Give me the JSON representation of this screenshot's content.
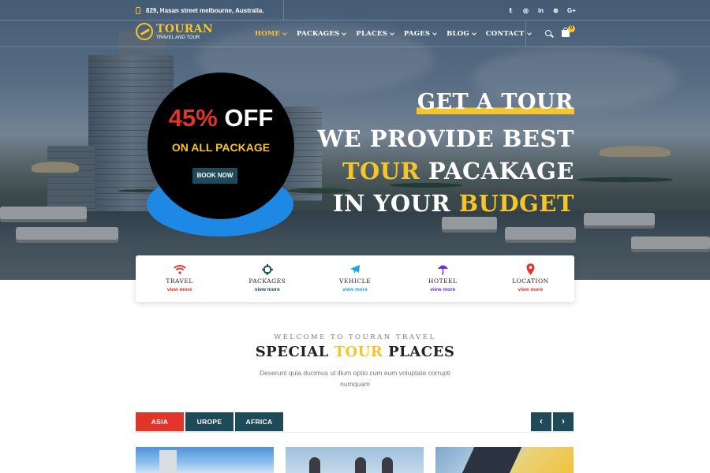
{
  "topbar": {
    "address": "829, Hasan street melbourne, Australia.",
    "socials": [
      {
        "icon": "twitter-icon",
        "glyph": "𝕥"
      },
      {
        "icon": "instagram-icon",
        "glyph": "◎"
      },
      {
        "icon": "linkedin-icon",
        "glyph": "in"
      },
      {
        "icon": "dribbble-icon",
        "glyph": "⊛"
      },
      {
        "icon": "google-plus-icon",
        "glyph": "G+"
      }
    ]
  },
  "brand": {
    "name": "TOURAN",
    "tagline": "TRAVEL AND TOUR"
  },
  "nav": {
    "items": [
      {
        "label": "HOME",
        "active": true
      },
      {
        "label": "PACKAGES"
      },
      {
        "label": "PLACES"
      },
      {
        "label": "PAGES"
      },
      {
        "label": "BLOG"
      },
      {
        "label": "CONTACT"
      }
    ],
    "cart_count": "0"
  },
  "offer": {
    "percent": "45%",
    "off": "OFF",
    "subtitle": "ON ALL PACKAGE",
    "button": "BOOK NOW"
  },
  "hero": {
    "kicker": "GET A TOUR",
    "line1": "WE PROVIDE BEST",
    "line2_highlight": "TOUR",
    "line2_rest": "PACAKAGE",
    "line3_start": "IN YOUR",
    "line3_highlight": "BUDGET"
  },
  "features": [
    {
      "title": "TRAVEL",
      "link": "view more",
      "icon": "wifi-icon",
      "color": "#e3342a"
    },
    {
      "title": "PACKAGES",
      "link": "view more",
      "icon": "crosshair-icon",
      "color": "#1e4a5a"
    },
    {
      "title": "VEHICLE",
      "link": "view more",
      "icon": "airplane-icon",
      "color": "#1ba8d8"
    },
    {
      "title": "HOTEEL",
      "link": "view more",
      "icon": "umbrella-icon",
      "color": "#6a2fd6"
    },
    {
      "title": "LOCATION",
      "link": "view more",
      "icon": "map-pin-icon",
      "color": "#e3342a"
    }
  ],
  "places_section": {
    "kicker": "WELCOME TO TOURAN TRAVEL",
    "title_start": "SPECIAL",
    "title_highlight": "TOUR",
    "title_end": "PLACES",
    "description": "Deserunt quia ducimus ut illum optio cum eum voluptate corrupti numquam",
    "tabs": [
      "ASIA",
      "UROPE",
      "AFRICA"
    ],
    "prev": "‹",
    "next": "›"
  },
  "colors": {
    "accent_yellow": "#f6c42b",
    "accent_red": "#e3342a",
    "dark_teal": "#1e4a5a",
    "offer_blue": "#1e88e5"
  }
}
